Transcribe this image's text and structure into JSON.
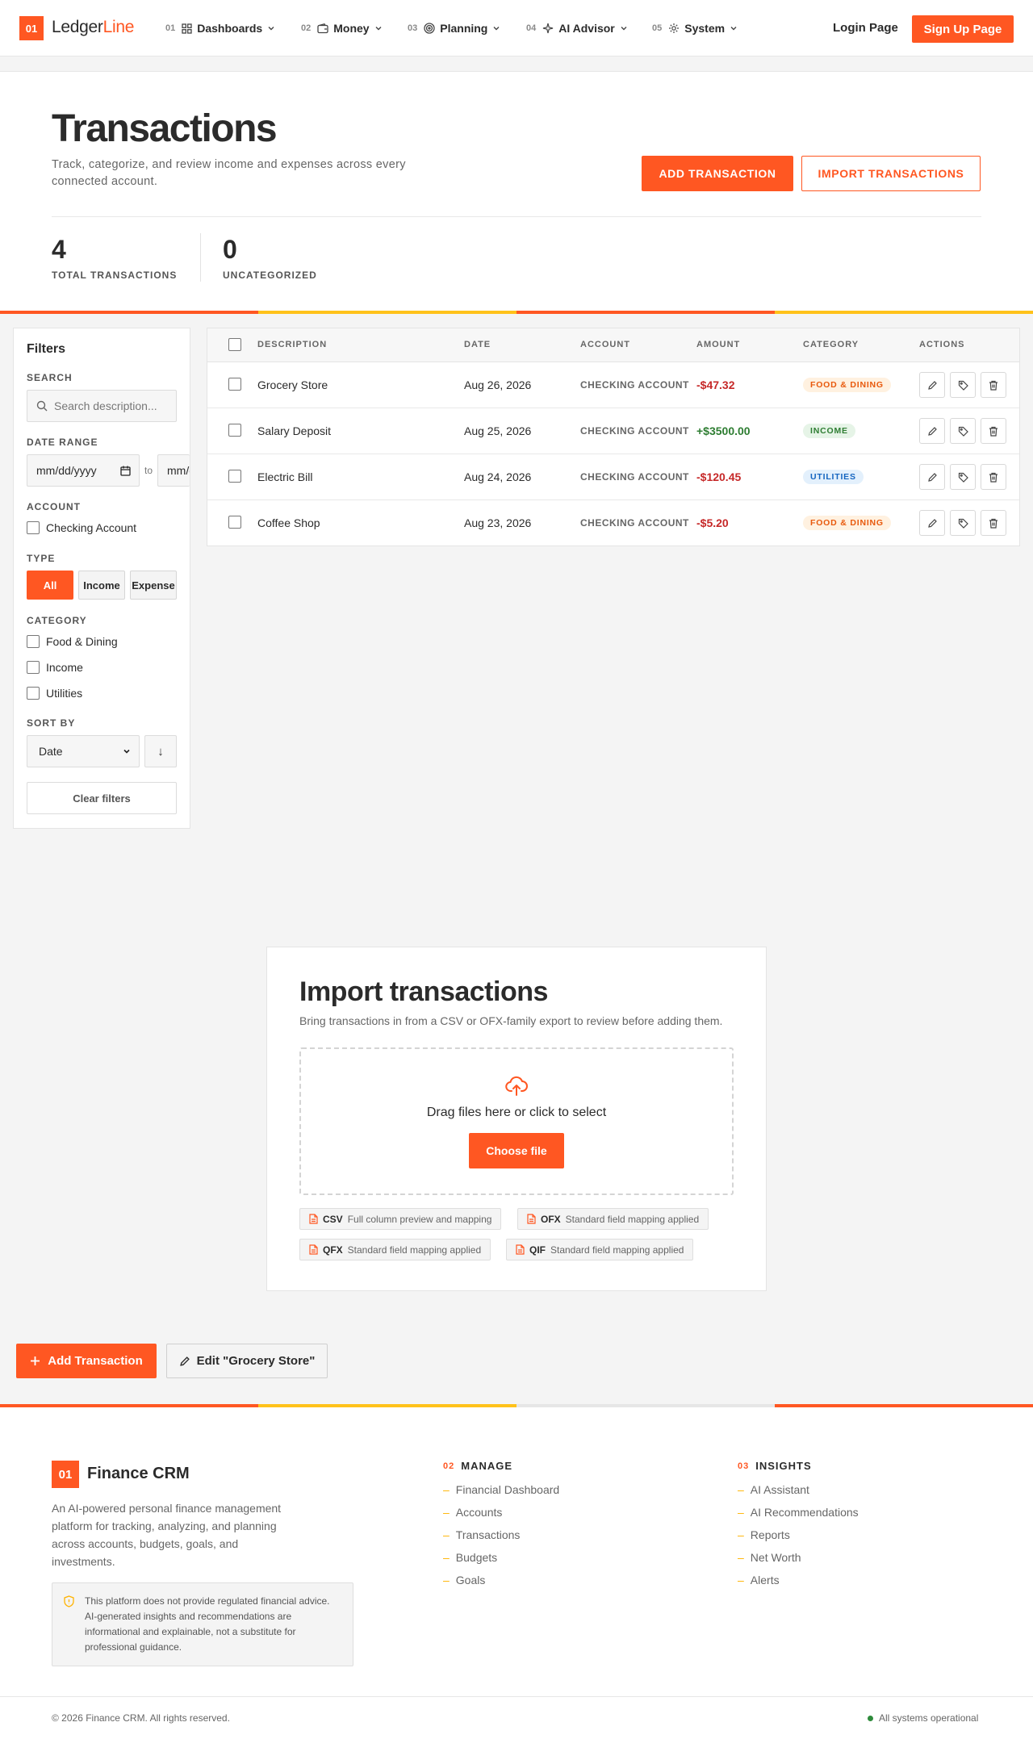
{
  "nav": {
    "logo_badge": "01",
    "logo_part1": "Ledger",
    "logo_part2": "Line",
    "items": [
      {
        "num": "01",
        "label": "Dashboards",
        "icon": "grid-icon"
      },
      {
        "num": "02",
        "label": "Money",
        "icon": "wallet-icon"
      },
      {
        "num": "03",
        "label": "Planning",
        "icon": "target-icon"
      },
      {
        "num": "04",
        "label": "AI Advisor",
        "icon": "sparkle-icon"
      },
      {
        "num": "05",
        "label": "System",
        "icon": "gear-icon"
      }
    ],
    "login": "Login Page",
    "signup": "Sign Up Page"
  },
  "hero": {
    "title": "Transactions",
    "subtitle": "Track, categorize, and review income and expenses across every connected account.",
    "add_button": "ADD TRANSACTION",
    "import_button": "IMPORT TRANSACTIONS",
    "stats": [
      {
        "value": "4",
        "label": "TOTAL TRANSACTIONS"
      },
      {
        "value": "0",
        "label": "UNCATEGORIZED"
      }
    ]
  },
  "filters": {
    "title": "Filters",
    "search_label": "SEARCH",
    "search_placeholder": "Search description...",
    "date_label": "DATE RANGE",
    "date_from": "mm/dd/yyyy",
    "date_to": "mm/dd/yyyy",
    "date_sep": "to",
    "account_label": "ACCOUNT",
    "accounts": [
      "Checking Account"
    ],
    "type_label": "TYPE",
    "types": [
      "All",
      "Income",
      "Expense"
    ],
    "type_selected": "All",
    "category_label": "CATEGORY",
    "categories": [
      "Food & Dining",
      "Income",
      "Utilities"
    ],
    "sort_label": "SORT BY",
    "sort_value": "Date",
    "sort_dir": "↓",
    "clear": "Clear filters"
  },
  "table": {
    "headers": [
      "DESCRIPTION",
      "DATE",
      "ACCOUNT",
      "AMOUNT",
      "CATEGORY",
      "ACTIONS"
    ],
    "rows": [
      {
        "description": "Grocery Store",
        "date": "Aug 26, 2026",
        "account": "CHECKING ACCOUNT",
        "amount": "-$47.32",
        "category": "FOOD & DINING"
      },
      {
        "description": "Salary Deposit",
        "date": "Aug 25, 2026",
        "account": "CHECKING ACCOUNT",
        "amount": "+$3500.00",
        "category": "INCOME"
      },
      {
        "description": "Electric Bill",
        "date": "Aug 24, 2026",
        "account": "CHECKING ACCOUNT",
        "amount": "-$120.45",
        "category": "UTILITIES"
      },
      {
        "description": "Coffee Shop",
        "date": "Aug 23, 2026",
        "account": "CHECKING ACCOUNT",
        "amount": "-$5.20",
        "category": "FOOD & DINING"
      }
    ]
  },
  "import": {
    "title": "Import transactions",
    "subtitle": "Bring transactions in from a CSV or OFX-family export to review before adding them.",
    "drop_text": "Drag files here or click to select",
    "choose": "Choose file",
    "formats": [
      {
        "name": "CSV",
        "desc": "Full column preview and mapping"
      },
      {
        "name": "OFX",
        "desc": "Standard field mapping applied"
      },
      {
        "name": "QFX",
        "desc": "Standard field mapping applied"
      },
      {
        "name": "QIF",
        "desc": "Standard field mapping applied"
      }
    ]
  },
  "actions": {
    "add": "Add Transaction",
    "edit": "Edit \"Grocery Store\""
  },
  "footer": {
    "badge": "01",
    "brand": "Finance CRM",
    "description": "An AI-powered personal finance management platform for tracking, analyzing, and planning across accounts, budgets, goals, and investments.",
    "note": "This platform does not provide regulated financial advice. AI-generated insights and recommendations are informational and explainable, not a substitute for professional guidance.",
    "manage": {
      "num": "02",
      "title": "MANAGE",
      "links": [
        "Financial Dashboard",
        "Accounts",
        "Transactions",
        "Budgets",
        "Goals"
      ]
    },
    "insights": {
      "num": "03",
      "title": "INSIGHTS",
      "links": [
        "AI Assistant",
        "AI Recommendations",
        "Reports",
        "Net Worth",
        "Alerts"
      ]
    },
    "copyright": "© 2026 Finance CRM. All rights reserved.",
    "status": "All systems operational"
  },
  "colors": {
    "accent": "#ff5722",
    "accent_yellow": "#ffc21a",
    "negative": "#c62828",
    "positive": "#2e7d32",
    "badge_food_bg": "#fff1e0",
    "badge_food_fg": "#e8590c",
    "badge_income_bg": "#e6f4e7",
    "badge_income_fg": "#2e7d32",
    "badge_util_bg": "#e3f0fc",
    "badge_util_fg": "#1565c0"
  }
}
